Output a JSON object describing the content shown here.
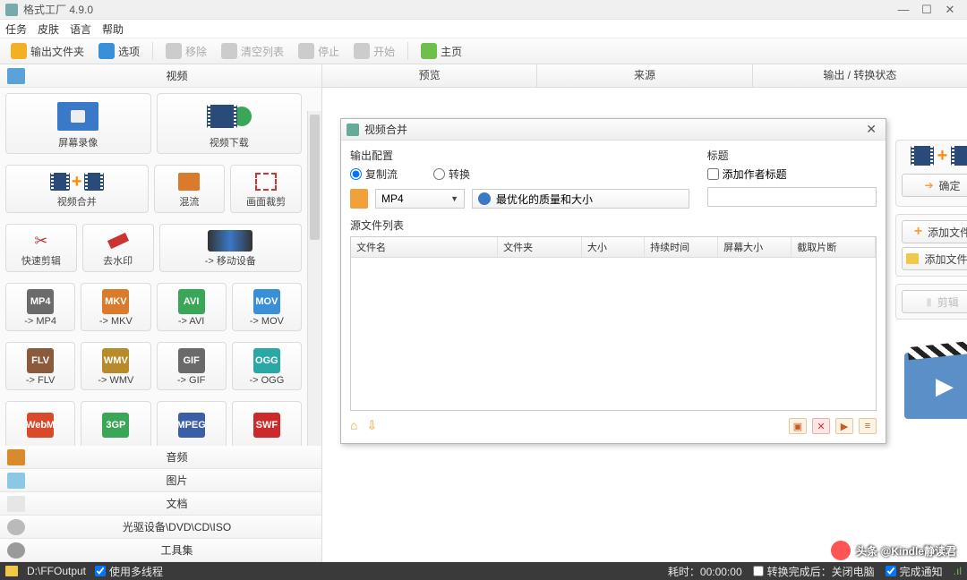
{
  "app": {
    "title": "格式工厂 4.9.0"
  },
  "window_controls": {
    "min": "—",
    "max": "☐",
    "close": "✕"
  },
  "menu": [
    "任务",
    "皮肤",
    "语言",
    "帮助"
  ],
  "toolbar": [
    {
      "label": "输出文件夹",
      "color": "#f2b024",
      "disabled": false
    },
    {
      "label": "选项",
      "color": "#3a8fd9",
      "disabled": false
    },
    {
      "label": "移除",
      "color": "#cccccc",
      "disabled": true
    },
    {
      "label": "清空列表",
      "color": "#cccccc",
      "disabled": true
    },
    {
      "label": "停止",
      "color": "#cccccc",
      "disabled": true
    },
    {
      "label": "开始",
      "color": "#cccccc",
      "disabled": true
    },
    {
      "label": "主页",
      "color": "#6fbf4d",
      "disabled": false
    }
  ],
  "categories": {
    "video": "视频",
    "audio": "音频",
    "picture": "图片",
    "document": "文档",
    "disc": "光驱设备\\DVD\\CD\\ISO",
    "tools": "工具集"
  },
  "video_big_tiles": [
    {
      "label": "屏幕录像"
    },
    {
      "label": "视频下载"
    }
  ],
  "video_mid_tiles_a": [
    {
      "label": "视频合并"
    },
    {
      "label": "混流"
    },
    {
      "label": "画面裁剪"
    }
  ],
  "video_mid_tiles_b": [
    {
      "label": "快速剪辑"
    },
    {
      "label": "去水印"
    },
    {
      "label": "-> 移动设备"
    }
  ],
  "video_fmt_tiles_1": [
    {
      "label": "-> MP4",
      "badge": "MP4",
      "bg": "#6b6b6b"
    },
    {
      "label": "-> MKV",
      "badge": "MKV",
      "bg": "#d97b2a"
    },
    {
      "label": "-> AVI",
      "badge": "AVI",
      "bg": "#3aa657"
    },
    {
      "label": "-> MOV",
      "badge": "MOV",
      "bg": "#3a8fd9"
    }
  ],
  "video_fmt_tiles_2": [
    {
      "label": "-> FLV",
      "badge": "FLV",
      "bg": "#8a5a3a"
    },
    {
      "label": "-> WMV",
      "badge": "WMV",
      "bg": "#b88a2a"
    },
    {
      "label": "-> GIF",
      "badge": "GIF",
      "bg": "#6a6a6a"
    },
    {
      "label": "-> OGG",
      "badge": "OGG",
      "bg": "#2aa8a8"
    }
  ],
  "video_fmt_tiles_3": [
    {
      "label": "",
      "badge": "WebM",
      "bg": "#d94a2a"
    },
    {
      "label": "",
      "badge": "3GP",
      "bg": "#3aa657"
    },
    {
      "label": "",
      "badge": "MPEG",
      "bg": "#3a5fa6"
    },
    {
      "label": "",
      "badge": "SWF",
      "bg": "#cc2a2a"
    }
  ],
  "tabs": [
    "预览",
    "来源",
    "输出 / 转换状态"
  ],
  "dialog": {
    "title": "视频合并",
    "output_cfg": "输出配置",
    "radio_copy": "复制流",
    "radio_convert": "转换",
    "format": "MP4",
    "optimize": "最优化的质量和大小",
    "title_field": "标题",
    "add_author_title": "添加作者标题",
    "src_list": "源文件列表",
    "columns": [
      "文件名",
      "文件夹",
      "大小",
      "持续时间",
      "屏幕大小",
      "截取片断"
    ],
    "ok": "确定",
    "add_file": "添加文件",
    "add_folder": "添加文件夹",
    "cut": "剪辑"
  },
  "statusbar": {
    "output": "D:\\FFOutput",
    "multithread": "使用多线程",
    "elapsed_label": "耗时：",
    "elapsed": "00:00:00",
    "after_done": "转换完成后：关闭电脑",
    "notify": "完成通知"
  },
  "watermark": "头条 @Kindle静读君"
}
